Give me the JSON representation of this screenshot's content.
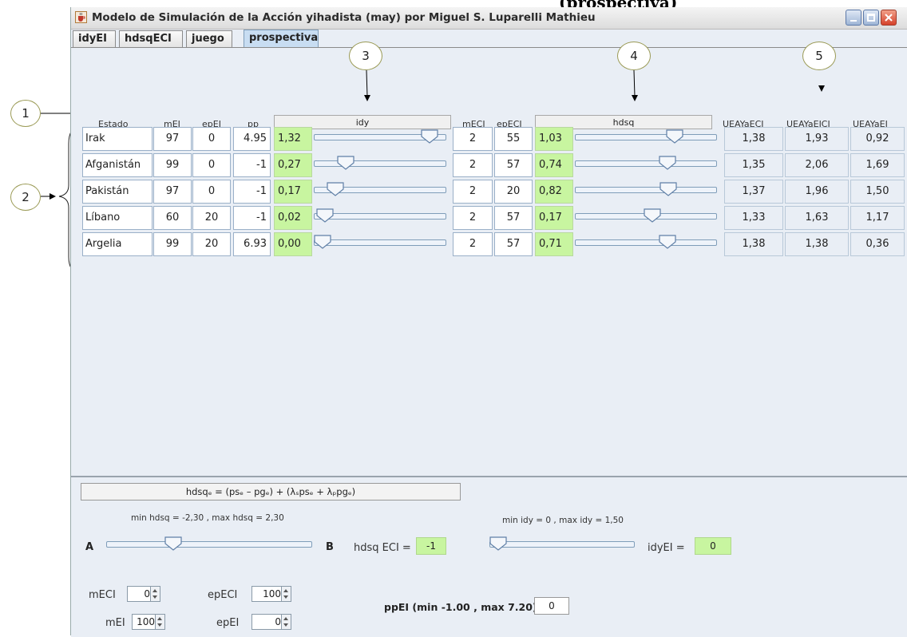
{
  "window": {
    "title": "Modelo de Simulación de la Acción yihadista (may) por Miguel S. Luparelli Mathieu",
    "cropped_heading": "(prospectiva)"
  },
  "tabs": [
    {
      "label": "idyEI"
    },
    {
      "label": "hdsqECI"
    },
    {
      "label": "juego"
    },
    {
      "label": "prospectiva",
      "active": true
    }
  ],
  "callouts": {
    "c1": "1",
    "c2": "2",
    "c3": "3",
    "c4": "4",
    "c5": "5"
  },
  "columns": {
    "estado": "Estado",
    "mEI": "mEI",
    "epEI": "epEI",
    "pp": "pp",
    "idy": "idy",
    "mECI": "mECI",
    "epECI": "epECI",
    "hdsq": "hdsq",
    "ueay1": "UEAYaECI",
    "ueay2": "UEAYaEICI",
    "ueay3": "UEAYaEI"
  },
  "rows": [
    {
      "estado": "Irak",
      "mEI": "97",
      "epEI": "0",
      "pp": "4.95",
      "idy": "1,32",
      "idy_slider": 0.93,
      "mECI": "2",
      "epECI": "55",
      "hdsq": "1,03",
      "hdsq_slider": 0.73,
      "u1": "1,38",
      "u2": "1,93",
      "u3": "0,92"
    },
    {
      "estado": "Afganistán",
      "mEI": "99",
      "epEI": "0",
      "pp": "-1",
      "idy": "0,27",
      "idy_slider": 0.2,
      "mECI": "2",
      "epECI": "57",
      "hdsq": "0,74",
      "hdsq_slider": 0.67,
      "u1": "1,35",
      "u2": "2,06",
      "u3": "1,69"
    },
    {
      "estado": "Pakistán",
      "mEI": "97",
      "epEI": "0",
      "pp": "-1",
      "idy": "0,17",
      "idy_slider": 0.11,
      "mECI": "2",
      "epECI": "20",
      "hdsq": "0,82",
      "hdsq_slider": 0.68,
      "u1": "1,37",
      "u2": "1,96",
      "u3": "1,50"
    },
    {
      "estado": "Líbano",
      "mEI": "60",
      "epEI": "20",
      "pp": "-1",
      "idy": "0,02",
      "idy_slider": 0.02,
      "mECI": "2",
      "epECI": "57",
      "hdsq": "0,17",
      "hdsq_slider": 0.55,
      "u1": "1,33",
      "u2": "1,63",
      "u3": "1,17"
    },
    {
      "estado": "Argelia",
      "mEI": "99",
      "epEI": "20",
      "pp": "6.93",
      "idy": "0,00",
      "idy_slider": 0.0,
      "mECI": "2",
      "epECI": "57",
      "hdsq": "0,71",
      "hdsq_slider": 0.67,
      "u1": "1,38",
      "u2": "1,38",
      "u3": "0,36"
    }
  ],
  "bottom": {
    "formula": "hdsqₑ = (psₑ – pgₑ)  + (λₛpsₑ + λₚpgₑ)",
    "hdsq_range": "min hdsq = -2,30 , max hdsq = 2,30",
    "label_a": "A",
    "label_b": "B",
    "ab_slider": 0.31,
    "hdsq_eci_label": "hdsq ECI =",
    "hdsq_eci_value": "-1",
    "idy_range": "min idy = 0 , max idy = 1,50",
    "idy_slider": 0.0,
    "idyei_label": "idyEI =",
    "idyei_value": "0",
    "meci_label": "mECI",
    "meci_value": "0",
    "epeci_label": "epECI",
    "epeci_value": "100",
    "mei_label": "mEI",
    "mei_value": "100",
    "epei_label": "epEI",
    "epei_value": "0",
    "ppei_label": "ppEI (min -1.00 , max 7.20)",
    "ppei_value": "0"
  }
}
